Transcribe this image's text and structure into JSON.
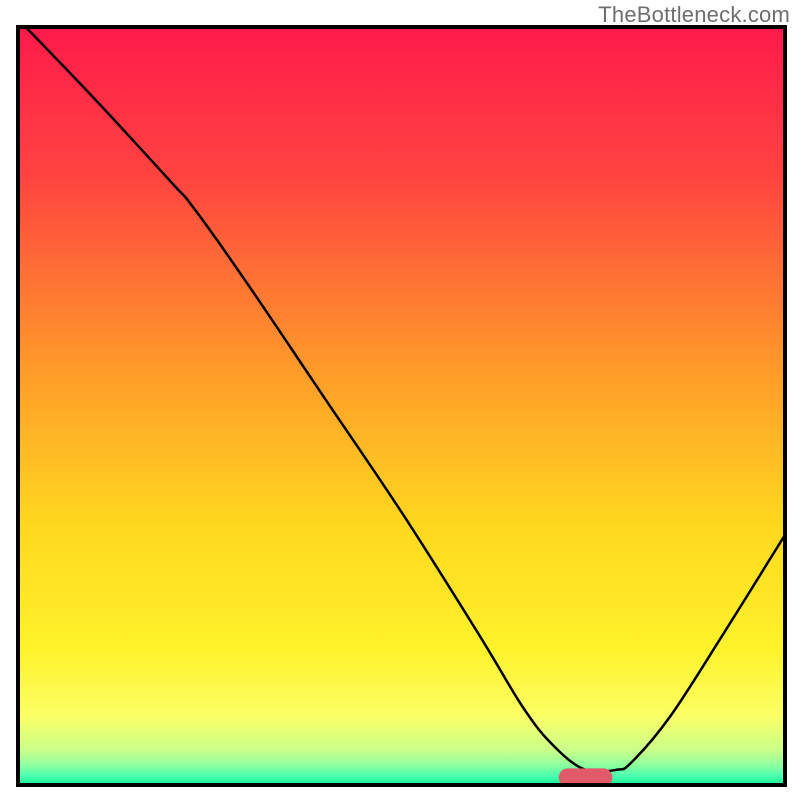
{
  "watermark": "TheBottleneck.com",
  "chart_data": {
    "type": "line",
    "title": "",
    "xlabel": "",
    "ylabel": "",
    "xlim": [
      0,
      100
    ],
    "ylim": [
      0,
      100
    ],
    "grid": false,
    "background_gradient_stops": [
      {
        "offset": 0.0,
        "color": "#ff1a4b"
      },
      {
        "offset": 0.2,
        "color": "#ff4440"
      },
      {
        "offset": 0.45,
        "color": "#ff9a2a"
      },
      {
        "offset": 0.65,
        "color": "#ffd61f"
      },
      {
        "offset": 0.82,
        "color": "#fff22a"
      },
      {
        "offset": 0.91,
        "color": "#fbff66"
      },
      {
        "offset": 0.955,
        "color": "#c8ff8a"
      },
      {
        "offset": 0.975,
        "color": "#8affa0"
      },
      {
        "offset": 0.99,
        "color": "#3fffb0"
      },
      {
        "offset": 1.0,
        "color": "#17e88a"
      }
    ],
    "series": [
      {
        "name": "bottleneck-curve",
        "color": "#000000",
        "x": [
          1,
          10,
          20,
          23,
          30,
          40,
          50,
          60,
          66,
          70,
          74,
          78,
          80,
          85,
          92,
          100
        ],
        "y": [
          100,
          90.5,
          79.5,
          76,
          66,
          51,
          36,
          20,
          10,
          5,
          2,
          2,
          3,
          9,
          20,
          33
        ]
      }
    ],
    "marker": {
      "name": "optimal-range",
      "shape": "pill",
      "color": "#e05a6a",
      "x_start": 70.5,
      "x_end": 77.5,
      "y": 1.0,
      "height": 2.4
    },
    "frame": {
      "color": "#000000",
      "width": 4
    }
  }
}
